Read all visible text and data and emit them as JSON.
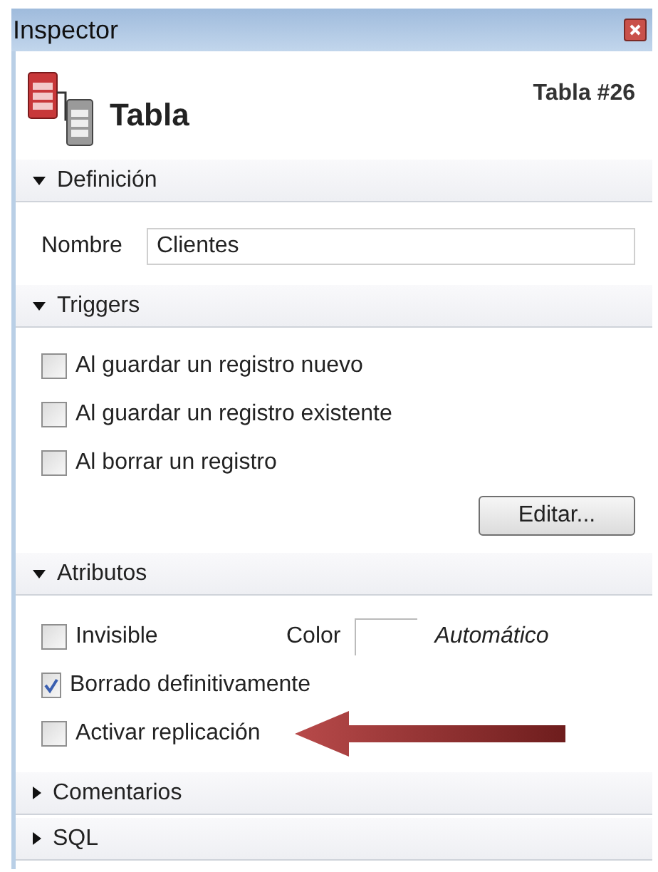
{
  "window": {
    "title": "Inspector"
  },
  "header": {
    "title": "Tabla",
    "id_label": "Tabla #26"
  },
  "sections": [
    {
      "title": "Definición",
      "expanded": true,
      "kind": "fields",
      "fields": [
        {
          "label": "Nombre",
          "value": "Clientes"
        }
      ]
    },
    {
      "title": "Triggers",
      "expanded": true,
      "kind": "checklist",
      "items": [
        {
          "label": "Al guardar un registro nuevo",
          "checked": false
        },
        {
          "label": "Al guardar un registro existente",
          "checked": false
        },
        {
          "label": "Al borrar un registro",
          "checked": false
        }
      ],
      "button": "Editar..."
    },
    {
      "title": "Atributos",
      "expanded": true,
      "kind": "attributes",
      "items": [
        {
          "label": "Invisible",
          "checked": false,
          "color_label": "Color",
          "color_value": "Automático"
        },
        {
          "label": "Borrado definitivamente",
          "checked": true
        },
        {
          "label": "Activar replicación",
          "checked": false,
          "highlighted": true
        }
      ]
    },
    {
      "title": "Comentarios",
      "expanded": false
    },
    {
      "title": "SQL",
      "expanded": false
    }
  ]
}
